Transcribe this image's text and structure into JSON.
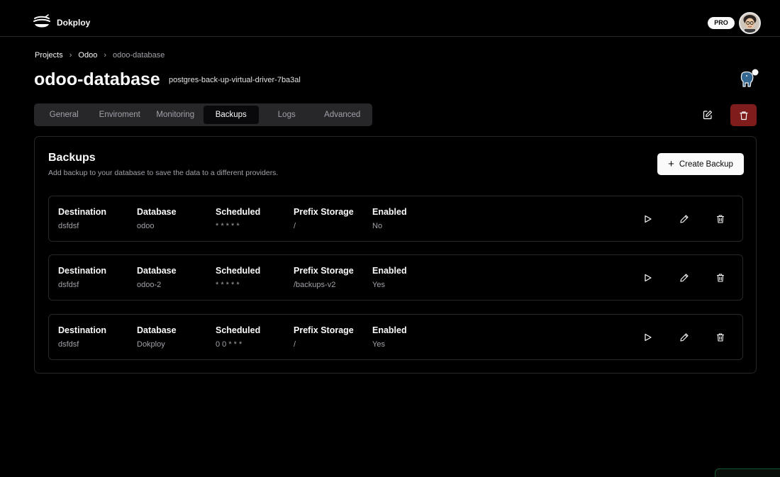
{
  "app": {
    "brand": "Dokploy",
    "plan_badge": "PRO"
  },
  "breadcrumb": [
    {
      "label": "Projects"
    },
    {
      "label": "Odoo"
    },
    {
      "label": "odoo-database"
    }
  ],
  "header": {
    "title": "odoo-database",
    "app_name": "postgres-back-up-virtual-driver-7ba3al"
  },
  "tabs": [
    {
      "label": "General",
      "active": false
    },
    {
      "label": "Enviroment",
      "active": false
    },
    {
      "label": "Monitoring",
      "active": false
    },
    {
      "label": "Backups",
      "active": true
    },
    {
      "label": "Logs",
      "active": false
    },
    {
      "label": "Advanced",
      "active": false
    }
  ],
  "backups": {
    "title": "Backups",
    "description": "Add backup to your database to save the data to a different providers.",
    "create_label": "Create Backup",
    "columns": [
      "Destination",
      "Database",
      "Scheduled",
      "Prefix Storage",
      "Enabled"
    ],
    "rows": [
      {
        "destination": "dsfdsf",
        "database": "odoo",
        "scheduled": "* * * * *",
        "prefix": "/",
        "enabled": "No"
      },
      {
        "destination": "dsfdsf",
        "database": "odoo-2",
        "scheduled": "* * * * *",
        "prefix": "/backups-v2",
        "enabled": "Yes"
      },
      {
        "destination": "dsfdsf",
        "database": "Dokploy",
        "scheduled": "0 0 * * *",
        "prefix": "/",
        "enabled": "Yes"
      }
    ]
  },
  "icons": {
    "logo": "dokploy-logo-icon",
    "database": "postgres-elephant-icon",
    "edit": "edit-square-icon",
    "delete": "trash-icon",
    "run": "play-icon",
    "row_edit": "pencil-icon",
    "row_delete": "trash-icon"
  },
  "colors": {
    "background": "#000000",
    "border": "#27272a",
    "muted_text": "#a1a1aa",
    "danger": "#7f1d1d",
    "primary_button": "#fafafa"
  }
}
